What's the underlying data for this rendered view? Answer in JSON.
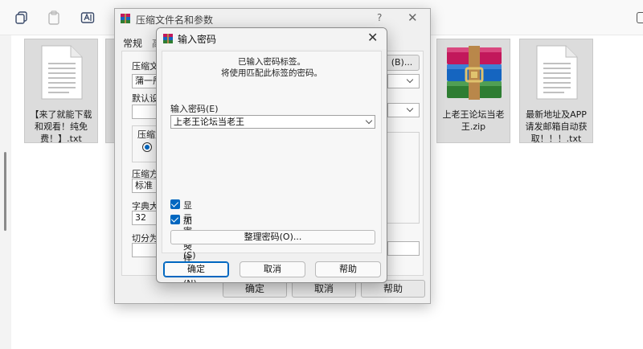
{
  "explorer": {
    "files": [
      {
        "name": "【来了就能下载和观看！纯免费！】.txt",
        "icon": "text-document-icon"
      },
      {
        "name": "上老王论坛当老王.zip",
        "icon": "winrar-archive-icon"
      },
      {
        "name": "最新地址及APP请发邮箱自动获取！！！.txt",
        "icon": "text-document-icon"
      }
    ],
    "toolbar_icons": [
      "copy-icon",
      "paste-icon",
      "rename-icon"
    ]
  },
  "archive_window": {
    "title": "压缩文件名和参数",
    "help_glyph": "?",
    "close_glyph": "✕",
    "tab_general": "常规",
    "tab_advanced_partial": "高",
    "archive_name_label_partial": "压缩文",
    "browse_label_partial": "(B)...",
    "profile_value_partial": "蒲一彤",
    "default_settings_partial": "默认设",
    "format_group_partial": "压缩文",
    "method_label_partial": "压缩方",
    "method_value": "标准",
    "dict_label_partial": "字典大",
    "dict_value": "32",
    "split_label_partial": "切分为",
    "ok_label": "确定",
    "cancel_label": "取消",
    "help_label": "帮助"
  },
  "password_dialog": {
    "title": "输入密码",
    "close_glyph": "✕",
    "info_line1": "已输入密码标签。",
    "info_line2": "将使用匹配此标签的密码。",
    "password_label": "输入密码(E)",
    "password_value": "上老王论坛当老王",
    "show_password_label": "显示密码(S)",
    "show_password_checked": true,
    "encrypt_names_label": "加密文件名(N)",
    "encrypt_names_checked": true,
    "organize_label": "整理密码(O)...",
    "ok_label": "确定",
    "cancel_label": "取消",
    "help_label": "帮助"
  },
  "colors": {
    "accent": "#0067c0",
    "tile_bg": "#dcdcdc",
    "dialog_bg": "#f0f0f0"
  }
}
